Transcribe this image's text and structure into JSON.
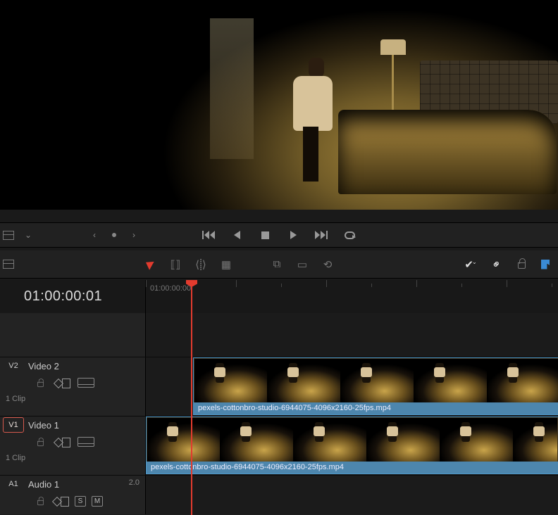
{
  "timecode": "01:00:00:01",
  "ruler_start_label": "01:00:00:00",
  "tracks": {
    "v2": {
      "dest": "V2",
      "name": "Video 2",
      "clipcount": "1 Clip",
      "clip_name": "pexels-cottonbro-studio-6944075-4096x2160-25fps.mp4"
    },
    "v1": {
      "dest": "V1",
      "name": "Video 1",
      "clipcount": "1 Clip",
      "clip_name": "pexels-cottonbro-studio-6944075-4096x2160-25fps.mp4"
    },
    "a1": {
      "dest": "A1",
      "name": "Audio 1",
      "channels": "2.0",
      "solo": "S",
      "mute": "M"
    }
  }
}
